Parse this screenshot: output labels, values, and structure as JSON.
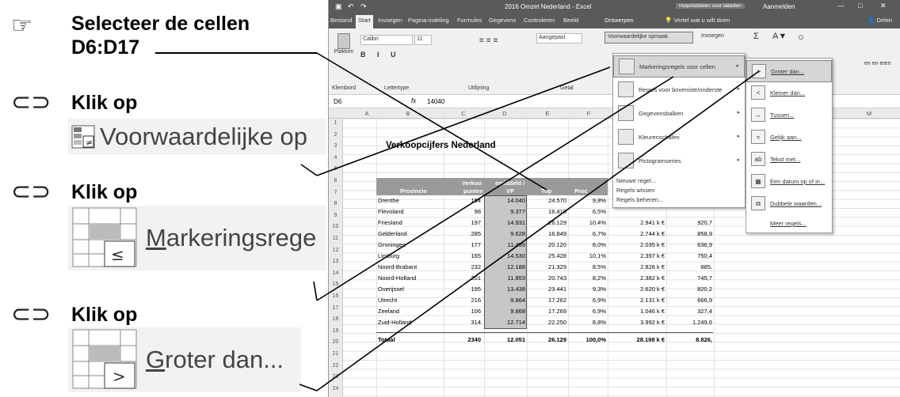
{
  "steps": {
    "select_text_1": "Selecteer de cellen",
    "select_text_2": "D6:D17",
    "click1": "Klik op",
    "click1_icon_label": "Voorwaardelijke op",
    "click2": "Klik op",
    "click2_icon_label_u": "M",
    "click2_icon_label": "arkeringsrege",
    "click3": "Klik op",
    "click3_icon_label_u": "G",
    "click3_icon_label": "roter dan..."
  },
  "excel": {
    "window_title": "2016 Omzet Nederland - Excel",
    "table_tools": "Hulpmiddelen voor tabellen",
    "signin": "Aanmelden",
    "tabs": [
      "Bestand",
      "Start",
      "Invoegen",
      "Pagina-indeling",
      "Formules",
      "Gegevens",
      "Controleren",
      "Beeld",
      "Ontwerpen"
    ],
    "tellme": "Vertel wat u wilt doen",
    "share": "Delen",
    "ribbon": {
      "paste": "Plakken",
      "font": "Calibri",
      "size": "11",
      "number_format": "Aangepast",
      "cond_format": "Voorwaardelijke opmaak",
      "insert": "Invoegen",
      "groups": [
        "Klembord",
        "Lettertype",
        "Uitlijning",
        "Getal"
      ],
      "right_partial": "en en eren"
    },
    "namebox": "D6",
    "formula_value": "14040",
    "columns": [
      "A",
      "B",
      "C",
      "D",
      "E",
      "F",
      "M"
    ],
    "rows": [
      "1",
      "2",
      "3",
      "4",
      "5",
      "6",
      "7",
      "8",
      "9",
      "10",
      "11",
      "12",
      "13",
      "14",
      "15",
      "16",
      "17",
      "18",
      "19",
      "20",
      "21",
      "22",
      "23",
      "24"
    ],
    "sheet_title": "Verkoopcijfers Nederland",
    "headers": {
      "provincie": "Provincie",
      "verkoop_top": "Verkoo",
      "verkoop_bottom": "punten",
      "gem_top": "emiddeld /",
      "gem_bottom": "VP",
      "top": "Top",
      "proc": "Proc"
    },
    "table_rows": [
      {
        "prov": "Drenthe",
        "vp": "154",
        "gem": "14.040",
        "top": "24.570",
        "pct": "9,8%",
        "g": "",
        "h": ""
      },
      {
        "prov": "Flevoland",
        "vp": "98",
        "gem": "9.377",
        "top": "16.410",
        "pct": "6,5%",
        "g": "",
        "h": ""
      },
      {
        "prov": "Friesland",
        "vp": "197",
        "gem": "14.931",
        "top": "26.129",
        "pct": "10,4%",
        "g": "2.941 k €",
        "h": "920,7"
      },
      {
        "prov": "Gelderland",
        "vp": "285",
        "gem": "9.628",
        "top": "16.849",
        "pct": "6,7%",
        "g": "2.744 k €",
        "h": "858,9"
      },
      {
        "prov": "Groningen",
        "vp": "177",
        "gem": "11.499",
        "top": "20.120",
        "pct": "8,0%",
        "g": "2.035 k €",
        "h": "636,9"
      },
      {
        "prov": "Limburg",
        "vp": "165",
        "gem": "14.530",
        "top": "25.428",
        "pct": "10,1%",
        "g": "2.397 k €",
        "h": "750,4"
      },
      {
        "prov": "Noord-Brabant",
        "vp": "232",
        "gem": "12.188",
        "top": "21.329",
        "pct": "8,5%",
        "g": "2.828 k €",
        "h": "885,"
      },
      {
        "prov": "Noord-Holland",
        "vp": "201",
        "gem": "11.853",
        "top": "20.743",
        "pct": "8,2%",
        "g": "2.382 k €",
        "h": "745,7"
      },
      {
        "prov": "Overijssel",
        "vp": "195",
        "gem": "13.438",
        "top": "23.441",
        "pct": "9,3%",
        "g": "2.620 k €",
        "h": "820,2"
      },
      {
        "prov": "Utrecht",
        "vp": "216",
        "gem": "9.864",
        "top": "17.262",
        "pct": "6,9%",
        "g": "2.131 k €",
        "h": "666,9"
      },
      {
        "prov": "Zeeland",
        "vp": "106",
        "gem": "9.868",
        "top": "17.269",
        "pct": "6,9%",
        "g": "1.046 k €",
        "h": "327,4"
      },
      {
        "prov": "Zuid-Holland",
        "vp": "314",
        "gem": "12.714",
        "top": "22.250",
        "pct": "8,8%",
        "g": "3.992 k €",
        "h": "1.249,6"
      }
    ],
    "total": {
      "label": "Totaal",
      "vp": "2340",
      "gem": "12.051",
      "top": "26.129",
      "pct": "100,0%",
      "g": "28.198 k €",
      "h": "8.826,"
    },
    "menu1": {
      "items": [
        "Markeringsregels voor cellen",
        "Regels voor boveniste/onderste",
        "Gegevensbalken",
        "Kleurenschalen",
        "Pictogramseries"
      ],
      "small": [
        "Nieuwe regel...",
        "Regels wissen",
        "Regels beheren..."
      ]
    },
    "menu2": {
      "items": [
        "Groter dan...",
        "Kleiner dan...",
        "Tussen...",
        "Gelijk aan...",
        "Tekst met...",
        "Een datum op of in...",
        "Dubbele waarden..."
      ],
      "more": "Meer regels..."
    }
  }
}
